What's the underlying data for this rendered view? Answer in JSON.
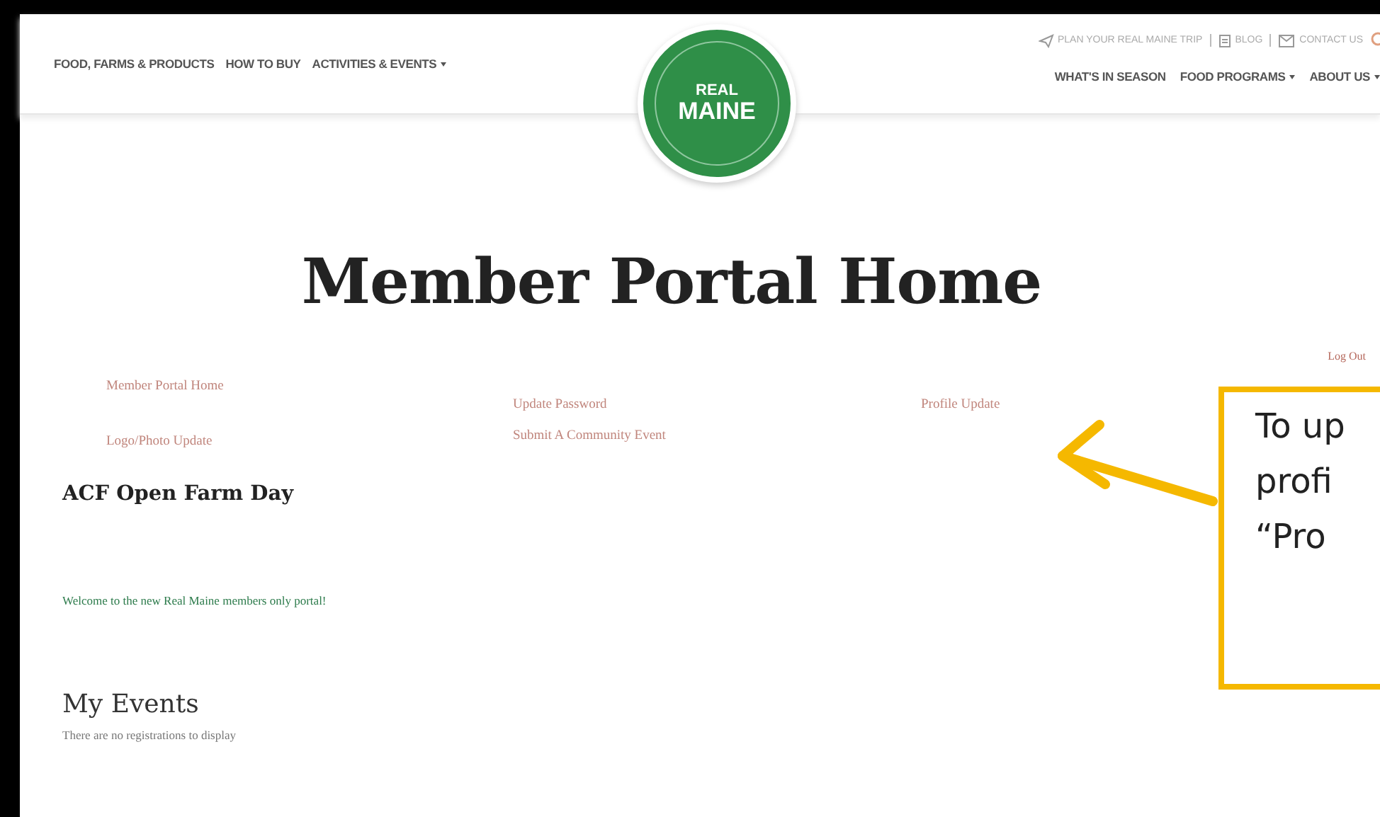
{
  "utility_links": [
    {
      "label": "PLAN YOUR REAL MAINE TRIP"
    },
    {
      "label": "BLOG"
    },
    {
      "label": "CONTACT US"
    }
  ],
  "nav_left": [
    {
      "label": "FOOD, FARMS & PRODUCTS",
      "dropdown": false
    },
    {
      "label": "HOW TO BUY",
      "dropdown": false
    },
    {
      "label": "ACTIVITIES & EVENTS",
      "dropdown": true
    }
  ],
  "logo": {
    "lines": [
      "REAL",
      "MAINE"
    ]
  },
  "nav_right": [
    {
      "label": "WHAT'S IN SEASON",
      "dropdown": false
    },
    {
      "label": "FOOD PROGRAMS",
      "dropdown": true
    },
    {
      "label": "ABOUT US",
      "dropdown": true
    }
  ],
  "page_title": "Member Portal Home",
  "logout": "Log Out",
  "portal_links": [
    [
      "Member Portal Home",
      "Logo/Photo Update"
    ],
    [
      "Update Password",
      "Submit A Community Event"
    ],
    [
      "Profile Update"
    ]
  ],
  "farm_name": "ACF Open Farm Day",
  "welcome": "Welcome to the new Real Maine members only portal!",
  "events": {
    "title": "My Events",
    "empty_text": "There are no registrations to display"
  },
  "callout": {
    "lines": [
      "To up",
      "profi",
      "“Pro"
    ]
  }
}
